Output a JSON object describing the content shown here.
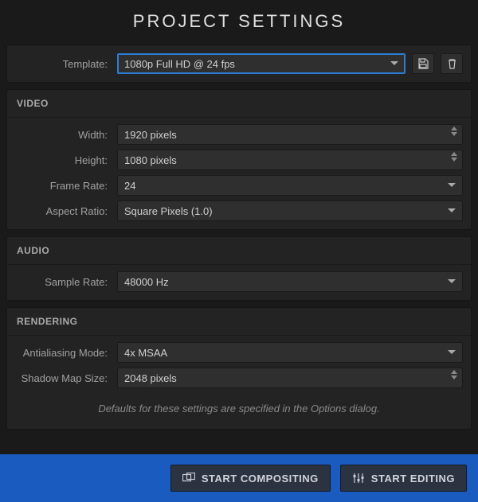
{
  "title": "PROJECT SETTINGS",
  "template": {
    "label": "Template:",
    "value": "1080p Full HD @ 24 fps"
  },
  "sections": {
    "video": {
      "header": "VIDEO",
      "width_label": "Width:",
      "width_value": "1920 pixels",
      "height_label": "Height:",
      "height_value": "1080 pixels",
      "framerate_label": "Frame Rate:",
      "framerate_value": "24",
      "aspect_label": "Aspect Ratio:",
      "aspect_value": "Square Pixels (1.0)"
    },
    "audio": {
      "header": "AUDIO",
      "samplerate_label": "Sample Rate:",
      "samplerate_value": "48000 Hz"
    },
    "rendering": {
      "header": "RENDERING",
      "aa_label": "Antialiasing Mode:",
      "aa_value": "4x MSAA",
      "shadow_label": "Shadow Map Size:",
      "shadow_value": "2048 pixels",
      "hint": "Defaults for these settings are specified in the Options dialog."
    }
  },
  "footer": {
    "compositing": "START COMPOSITING",
    "editing": "START EDITING"
  }
}
